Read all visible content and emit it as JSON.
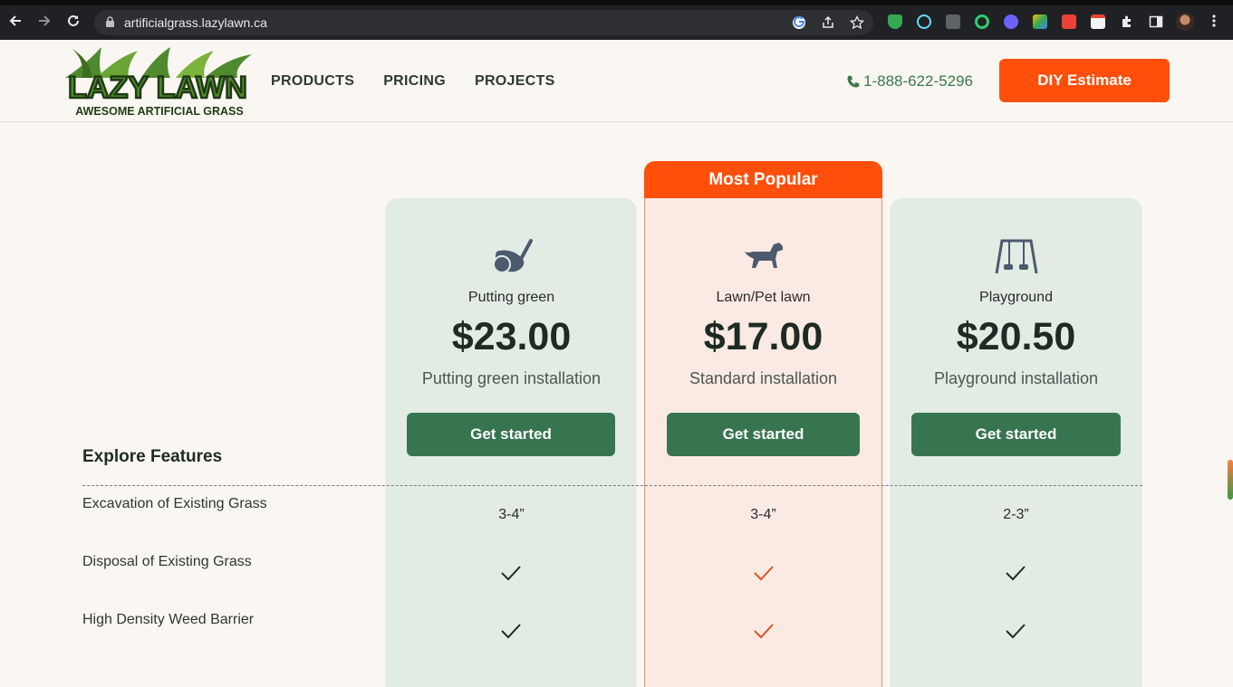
{
  "browser": {
    "url": "artificialgrass.lazylawn.ca"
  },
  "header": {
    "logo_text": "LAZY LAWN",
    "logo_tagline": "AWESOME ARTIFICIAL GRASS",
    "nav": [
      "PRODUCTS",
      "PRICING",
      "PROJECTS"
    ],
    "phone": "1-888-622-5296",
    "cta": "DIY Estimate"
  },
  "pricing": {
    "popular_badge": "Most Popular",
    "plans": [
      {
        "name": "Putting green",
        "price": "$23.00",
        "desc": "Putting green installation",
        "button": "Get started",
        "icon": "golf-club-icon"
      },
      {
        "name": "Lawn/Pet lawn",
        "price": "$17.00",
        "desc": "Standard installation",
        "button": "Get started",
        "icon": "dog-icon"
      },
      {
        "name": "Playground",
        "price": "$20.50",
        "desc": "Playground installation",
        "button": "Get started",
        "icon": "swing-set-icon"
      }
    ],
    "features_heading": "Explore Features",
    "features": [
      {
        "label": "Excavation of Existing Grass",
        "values": [
          "3-4”",
          "3-4”",
          "2-3”"
        ]
      },
      {
        "label": "Disposal of Existing Grass",
        "values": [
          "check",
          "check",
          "check"
        ]
      },
      {
        "label": "High Density Weed Barrier",
        "values": [
          "check",
          "check",
          "check"
        ]
      }
    ]
  },
  "colors": {
    "accent_orange": "#ff4f0a",
    "button_green": "#377550",
    "column_green": "#e2ece5",
    "column_popular": "#fbeae3"
  }
}
